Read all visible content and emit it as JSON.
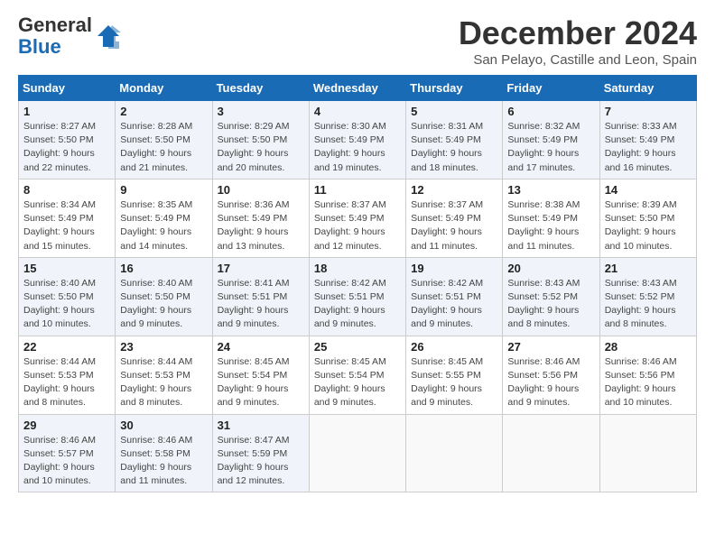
{
  "logo": {
    "line1": "General",
    "line2": "Blue"
  },
  "title": "December 2024",
  "subtitle": "San Pelayo, Castille and Leon, Spain",
  "weekdays": [
    "Sunday",
    "Monday",
    "Tuesday",
    "Wednesday",
    "Thursday",
    "Friday",
    "Saturday"
  ],
  "weeks": [
    [
      {
        "day": "1",
        "rise": "Sunrise: 8:27 AM",
        "set": "Sunset: 5:50 PM",
        "daylight": "Daylight: 9 hours and 22 minutes."
      },
      {
        "day": "2",
        "rise": "Sunrise: 8:28 AM",
        "set": "Sunset: 5:50 PM",
        "daylight": "Daylight: 9 hours and 21 minutes."
      },
      {
        "day": "3",
        "rise": "Sunrise: 8:29 AM",
        "set": "Sunset: 5:50 PM",
        "daylight": "Daylight: 9 hours and 20 minutes."
      },
      {
        "day": "4",
        "rise": "Sunrise: 8:30 AM",
        "set": "Sunset: 5:49 PM",
        "daylight": "Daylight: 9 hours and 19 minutes."
      },
      {
        "day": "5",
        "rise": "Sunrise: 8:31 AM",
        "set": "Sunset: 5:49 PM",
        "daylight": "Daylight: 9 hours and 18 minutes."
      },
      {
        "day": "6",
        "rise": "Sunrise: 8:32 AM",
        "set": "Sunset: 5:49 PM",
        "daylight": "Daylight: 9 hours and 17 minutes."
      },
      {
        "day": "7",
        "rise": "Sunrise: 8:33 AM",
        "set": "Sunset: 5:49 PM",
        "daylight": "Daylight: 9 hours and 16 minutes."
      }
    ],
    [
      {
        "day": "8",
        "rise": "Sunrise: 8:34 AM",
        "set": "Sunset: 5:49 PM",
        "daylight": "Daylight: 9 hours and 15 minutes."
      },
      {
        "day": "9",
        "rise": "Sunrise: 8:35 AM",
        "set": "Sunset: 5:49 PM",
        "daylight": "Daylight: 9 hours and 14 minutes."
      },
      {
        "day": "10",
        "rise": "Sunrise: 8:36 AM",
        "set": "Sunset: 5:49 PM",
        "daylight": "Daylight: 9 hours and 13 minutes."
      },
      {
        "day": "11",
        "rise": "Sunrise: 8:37 AM",
        "set": "Sunset: 5:49 PM",
        "daylight": "Daylight: 9 hours and 12 minutes."
      },
      {
        "day": "12",
        "rise": "Sunrise: 8:37 AM",
        "set": "Sunset: 5:49 PM",
        "daylight": "Daylight: 9 hours and 11 minutes."
      },
      {
        "day": "13",
        "rise": "Sunrise: 8:38 AM",
        "set": "Sunset: 5:49 PM",
        "daylight": "Daylight: 9 hours and 11 minutes."
      },
      {
        "day": "14",
        "rise": "Sunrise: 8:39 AM",
        "set": "Sunset: 5:50 PM",
        "daylight": "Daylight: 9 hours and 10 minutes."
      }
    ],
    [
      {
        "day": "15",
        "rise": "Sunrise: 8:40 AM",
        "set": "Sunset: 5:50 PM",
        "daylight": "Daylight: 9 hours and 10 minutes."
      },
      {
        "day": "16",
        "rise": "Sunrise: 8:40 AM",
        "set": "Sunset: 5:50 PM",
        "daylight": "Daylight: 9 hours and 9 minutes."
      },
      {
        "day": "17",
        "rise": "Sunrise: 8:41 AM",
        "set": "Sunset: 5:51 PM",
        "daylight": "Daylight: 9 hours and 9 minutes."
      },
      {
        "day": "18",
        "rise": "Sunrise: 8:42 AM",
        "set": "Sunset: 5:51 PM",
        "daylight": "Daylight: 9 hours and 9 minutes."
      },
      {
        "day": "19",
        "rise": "Sunrise: 8:42 AM",
        "set": "Sunset: 5:51 PM",
        "daylight": "Daylight: 9 hours and 9 minutes."
      },
      {
        "day": "20",
        "rise": "Sunrise: 8:43 AM",
        "set": "Sunset: 5:52 PM",
        "daylight": "Daylight: 9 hours and 8 minutes."
      },
      {
        "day": "21",
        "rise": "Sunrise: 8:43 AM",
        "set": "Sunset: 5:52 PM",
        "daylight": "Daylight: 9 hours and 8 minutes."
      }
    ],
    [
      {
        "day": "22",
        "rise": "Sunrise: 8:44 AM",
        "set": "Sunset: 5:53 PM",
        "daylight": "Daylight: 9 hours and 8 minutes."
      },
      {
        "day": "23",
        "rise": "Sunrise: 8:44 AM",
        "set": "Sunset: 5:53 PM",
        "daylight": "Daylight: 9 hours and 8 minutes."
      },
      {
        "day": "24",
        "rise": "Sunrise: 8:45 AM",
        "set": "Sunset: 5:54 PM",
        "daylight": "Daylight: 9 hours and 9 minutes."
      },
      {
        "day": "25",
        "rise": "Sunrise: 8:45 AM",
        "set": "Sunset: 5:54 PM",
        "daylight": "Daylight: 9 hours and 9 minutes."
      },
      {
        "day": "26",
        "rise": "Sunrise: 8:45 AM",
        "set": "Sunset: 5:55 PM",
        "daylight": "Daylight: 9 hours and 9 minutes."
      },
      {
        "day": "27",
        "rise": "Sunrise: 8:46 AM",
        "set": "Sunset: 5:56 PM",
        "daylight": "Daylight: 9 hours and 9 minutes."
      },
      {
        "day": "28",
        "rise": "Sunrise: 8:46 AM",
        "set": "Sunset: 5:56 PM",
        "daylight": "Daylight: 9 hours and 10 minutes."
      }
    ],
    [
      {
        "day": "29",
        "rise": "Sunrise: 8:46 AM",
        "set": "Sunset: 5:57 PM",
        "daylight": "Daylight: 9 hours and 10 minutes."
      },
      {
        "day": "30",
        "rise": "Sunrise: 8:46 AM",
        "set": "Sunset: 5:58 PM",
        "daylight": "Daylight: 9 hours and 11 minutes."
      },
      {
        "day": "31",
        "rise": "Sunrise: 8:47 AM",
        "set": "Sunset: 5:59 PM",
        "daylight": "Daylight: 9 hours and 12 minutes."
      },
      null,
      null,
      null,
      null
    ]
  ]
}
